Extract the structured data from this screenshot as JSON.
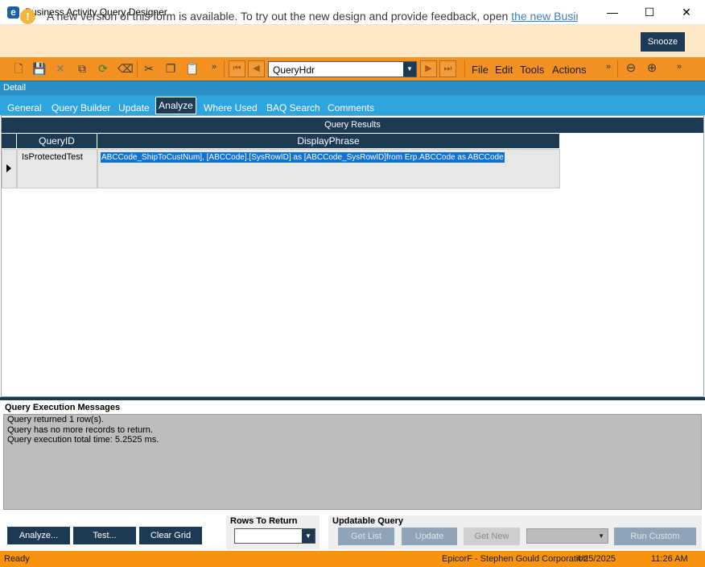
{
  "window": {
    "title": "Business Activity Query Designer",
    "app_icon": "e",
    "minimize": "—",
    "maximize": "☐",
    "close": "✕"
  },
  "banner": {
    "text": "A new version of this form is available. To try out the new design and provide feedback, open ",
    "link": "the new Business Activity Query (BAQ)",
    "snooze": "Snooze",
    "icon": "!"
  },
  "toolbar": {
    "icons": [
      "new-icon",
      "save-icon",
      "delete-icon",
      "copy-icon",
      "refresh-icon",
      "clear-icon",
      "cut-icon",
      "copy2-icon",
      "paste-icon"
    ],
    "more": "»",
    "record_select": "QueryHdr",
    "menus": [
      "File",
      "Edit",
      "Tools",
      "Actions"
    ]
  },
  "detail_label": "Detail",
  "tabs": [
    "General",
    "Query Builder",
    "Update",
    "Analyze",
    "Where Used",
    "BAQ Search",
    "Comments"
  ],
  "active_tab": "Analyze",
  "grid": {
    "title": "Query Results",
    "columns": [
      "QueryID",
      "DisplayPhrase"
    ],
    "rows": [
      {
        "QueryID": "IsProtectedTest",
        "DisplayPhrase": "ABCCode_ShipToCustNum],              [ABCCode].[SysRowID] as [ABCCode_SysRowID]from Erp.ABCCode as ABCCode"
      }
    ]
  },
  "messages": {
    "title": "Query Execution Messages",
    "lines": [
      "Query returned 1 row(s).",
      "Query has no more records to return.",
      "Query execution total time: 5.2525 ms."
    ]
  },
  "buttons": {
    "analyze": "Analyze...",
    "test": "Test...",
    "clear_grid": "Clear Grid"
  },
  "rows_to_return": {
    "title": "Rows To Return",
    "value": ""
  },
  "updatable": {
    "title": "Updatable Query",
    "get_list": "Get List",
    "update": "Update",
    "get_new": "Get New",
    "run_custom": "Run Custom"
  },
  "status": {
    "state": "Ready",
    "company": "EpicorF - Stephen Gould Corporation",
    "date": "4/25/2025",
    "time": "11:26 AM"
  },
  "colors": {
    "accent_orange": "#f39223",
    "navy": "#1d3a55",
    "tab_blue": "#2da4dd"
  }
}
